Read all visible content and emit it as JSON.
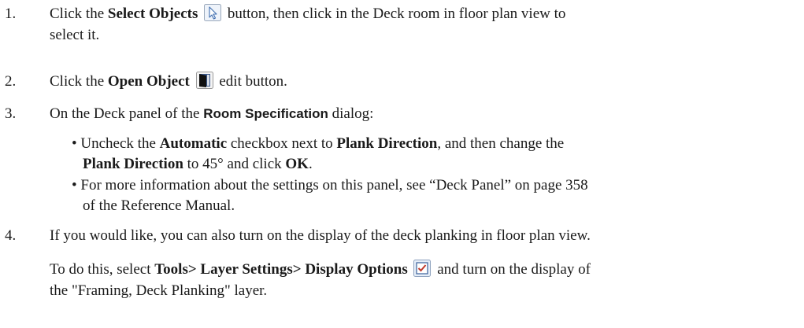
{
  "steps": [
    {
      "num": "1.",
      "parts": [
        "Click the ",
        "Select Objects",
        " button, then click in the Deck room in floor plan view to",
        "select it."
      ],
      "icon": "select-objects-arrow-icon"
    },
    {
      "num": "2.",
      "parts": [
        "Click the ",
        "Open Object",
        " edit button."
      ],
      "icon": "open-object-door-icon"
    },
    {
      "num": "3.",
      "parts": [
        "On the Deck panel of the ",
        "Room Specification",
        " dialog:"
      ],
      "bullets": [
        {
          "line1": [
            "Uncheck the ",
            "Automatic",
            " checkbox next to ",
            "Plank Direction",
            ", and then change the"
          ],
          "line2": [
            "Plank Direction",
            " to 45° and click ",
            "OK",
            "."
          ]
        },
        {
          "line1": [
            "For more information about the settings on this panel, see “Deck Panel” on page 358"
          ],
          "line2": [
            "of the Reference Manual."
          ]
        }
      ]
    },
    {
      "num": "4.",
      "parts": [
        "If you would like, you can also turn on the display of the deck planking in floor plan view."
      ],
      "para2": [
        "To do this, select ",
        "Tools> Layer Settings> Display Options",
        " and turn on the display of",
        "the \"Framing, Deck Planking\" layer."
      ],
      "icon": "display-options-checkbox-icon"
    }
  ],
  "bullet_char": "•"
}
